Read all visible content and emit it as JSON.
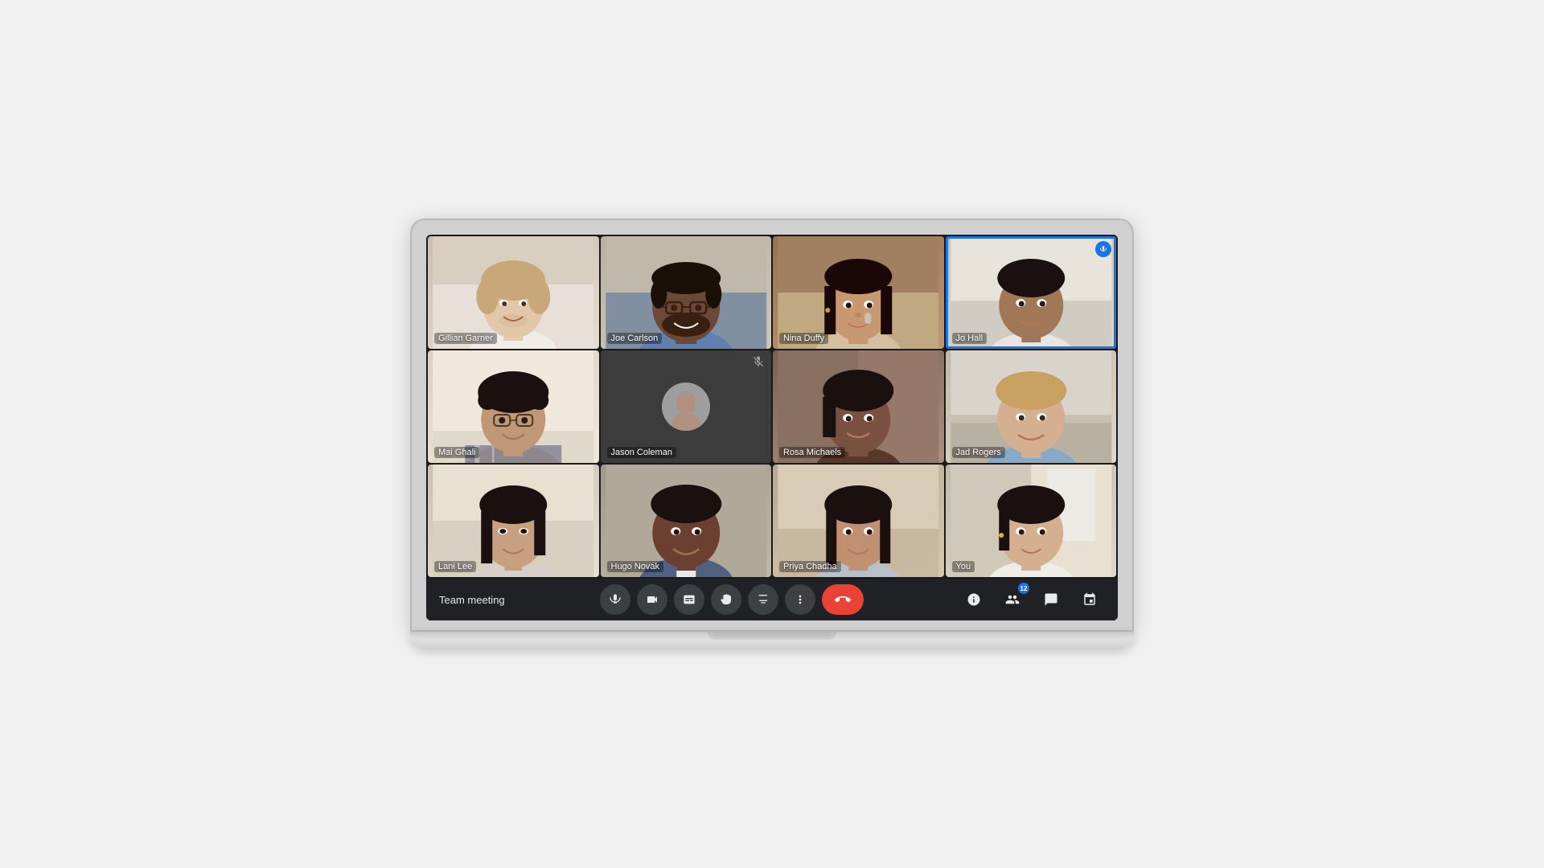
{
  "meeting": {
    "title": "Team meeting",
    "participants": [
      {
        "id": "gillian",
        "name": "Gillian Garner",
        "row": 0,
        "col": 0,
        "hasVideo": true,
        "muted": false,
        "activeSpeaker": false,
        "bgColor": "#d4c5b0",
        "skinTone": "#e8c9a8"
      },
      {
        "id": "joe",
        "name": "Joe Carlson",
        "row": 0,
        "col": 1,
        "hasVideo": true,
        "muted": false,
        "activeSpeaker": false,
        "bgColor": "#c8c0b0",
        "skinTone": "#7a5040"
      },
      {
        "id": "nina",
        "name": "Nina Duffy",
        "row": 0,
        "col": 2,
        "hasVideo": true,
        "muted": false,
        "activeSpeaker": false,
        "bgColor": "#b8946050",
        "skinTone": "#c89870"
      },
      {
        "id": "jo",
        "name": "Jo Hall",
        "row": 0,
        "col": 3,
        "hasVideo": true,
        "muted": false,
        "activeSpeaker": true,
        "bgColor": "#d8c8b8",
        "skinTone": "#a07050"
      },
      {
        "id": "mai",
        "name": "Mai Ghali",
        "row": 1,
        "col": 0,
        "hasVideo": true,
        "muted": false,
        "activeSpeaker": false,
        "bgColor": "#e0d8c8",
        "skinTone": "#c09878"
      },
      {
        "id": "jason",
        "name": "Jason Coleman",
        "row": 1,
        "col": 1,
        "hasVideo": false,
        "muted": true,
        "activeSpeaker": false,
        "bgColor": "#3c3c3c",
        "skinTone": "#a07860"
      },
      {
        "id": "rosa",
        "name": "Rosa Michaels",
        "row": 1,
        "col": 2,
        "hasVideo": true,
        "muted": false,
        "activeSpeaker": false,
        "bgColor": "#8b7060",
        "skinTone": "#7a5040"
      },
      {
        "id": "jad",
        "name": "Jad Rogers",
        "row": 1,
        "col": 3,
        "hasVideo": true,
        "muted": false,
        "activeSpeaker": false,
        "bgColor": "#c0b8a8",
        "skinTone": "#d4b090"
      },
      {
        "id": "lani",
        "name": "Lani Lee",
        "row": 2,
        "col": 0,
        "hasVideo": true,
        "muted": false,
        "activeSpeaker": false,
        "bgColor": "#d8c8b0",
        "skinTone": "#c8a080"
      },
      {
        "id": "hugo",
        "name": "Hugo Novak",
        "row": 2,
        "col": 1,
        "hasVideo": true,
        "muted": false,
        "activeSpeaker": false,
        "bgColor": "#b0a898",
        "skinTone": "#6b4030"
      },
      {
        "id": "priya",
        "name": "Priya Chadha",
        "row": 2,
        "col": 2,
        "hasVideo": true,
        "muted": false,
        "activeSpeaker": false,
        "bgColor": "#c8b8a0",
        "skinTone": "#c09070"
      },
      {
        "id": "you",
        "name": "You",
        "row": 2,
        "col": 3,
        "hasVideo": true,
        "muted": false,
        "activeSpeaker": false,
        "bgColor": "#c8c0b0",
        "skinTone": "#d4b090"
      }
    ],
    "toolbar": {
      "meetingTitle": "Team meeting",
      "micLabel": "Microphone",
      "cameraLabel": "Camera",
      "captionsLabel": "Captions",
      "raiseHandLabel": "Raise hand",
      "presentLabel": "Present now",
      "moreLabel": "More options",
      "endCallLabel": "Leave call",
      "infoLabel": "Meeting details",
      "participantsLabel": "Participants",
      "participantCount": "12",
      "chatLabel": "Chat",
      "activitiesLabel": "Activities"
    }
  }
}
